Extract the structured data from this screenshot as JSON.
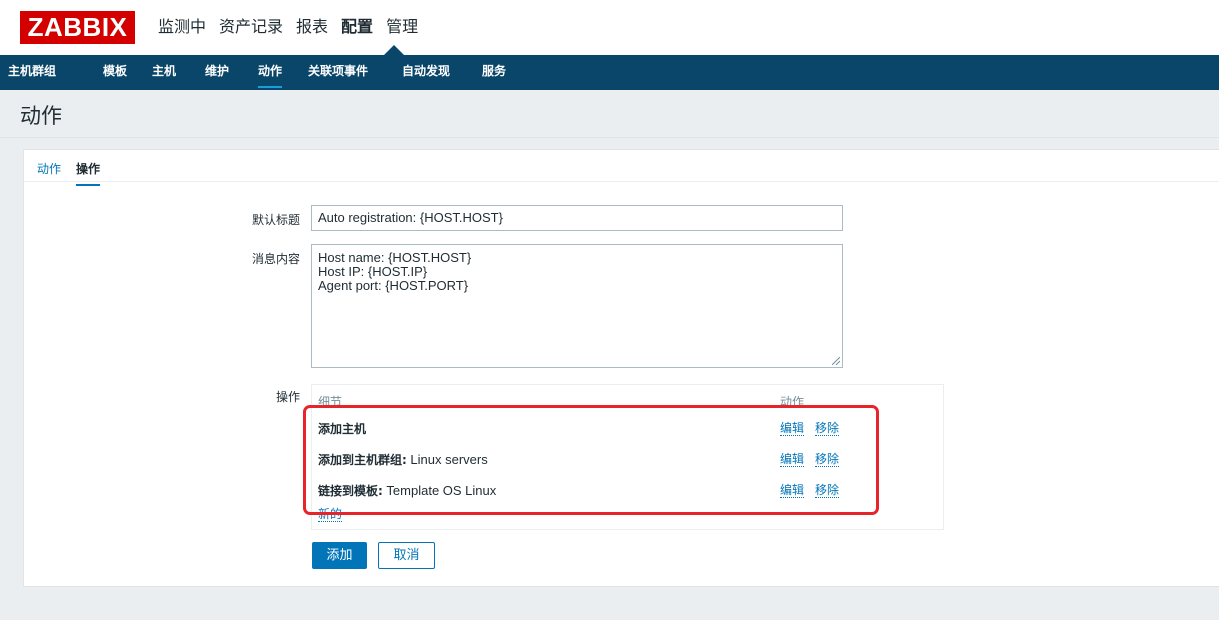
{
  "app": {
    "logo_text": "ZABBIX"
  },
  "main_menu": [
    "监测中",
    "资产记录",
    "报表",
    "配置",
    "管理"
  ],
  "active_main_menu": "配置",
  "sub_nav": [
    "主机群组",
    "模板",
    "主机",
    "维护",
    "动作",
    "关联项事件",
    "自动发现",
    "服务"
  ],
  "active_sub_nav": "动作",
  "page": {
    "title": "动作"
  },
  "tabs": [
    "动作",
    "操作"
  ],
  "active_tab": "操作",
  "form": {
    "default_subject_label": "默认标题",
    "default_subject_value": "Auto registration: {HOST.HOST}",
    "message_label": "消息内容",
    "message_lines": [
      "Host name: {HOST.HOST}",
      "Host IP: {HOST.IP}",
      "Agent port: {HOST.PORT}"
    ],
    "operations_label": "操作"
  },
  "operations": {
    "col_details": "细节",
    "col_action": "动作",
    "rows": [
      {
        "bold": "添加主机",
        "text": "",
        "edit": "编辑",
        "remove": "移除"
      },
      {
        "bold": "添加到主机群组:",
        "text": " Linux servers",
        "edit": "编辑",
        "remove": "移除"
      },
      {
        "bold": "链接到模板:",
        "text": " Template OS Linux",
        "edit": "编辑",
        "remove": "移除"
      }
    ],
    "new_link": "新的"
  },
  "buttons": {
    "add": "添加",
    "cancel": "取消"
  },
  "colors": {
    "brand": "#d40000",
    "nav_bg": "#0a466a",
    "link": "#0275b8",
    "highlight": "#e8242b"
  }
}
